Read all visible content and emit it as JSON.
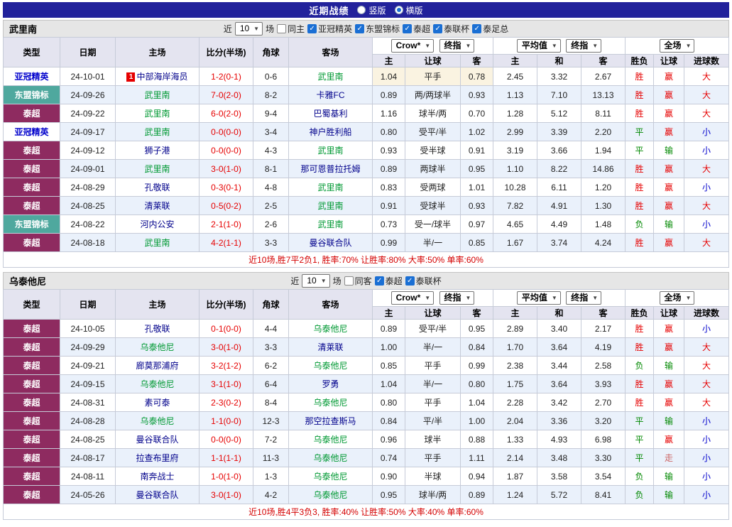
{
  "colors": {
    "topbar_bg": "#22229b",
    "section_bg": "#e6e6e6",
    "header_bg": "#e4e4f0",
    "row_alt_bg": "#eaf1fb",
    "border": "#c6cbd8",
    "score_red": "#e60000",
    "focal_team": "#009933",
    "opponent_team": "#00008b",
    "checkbox_blue": "#1a6fd4",
    "cream": "#faf3e1",
    "summary_red": "#d40000"
  },
  "top_bar": {
    "title": "近期战绩",
    "radio_vertical": "竖版",
    "radio_horizontal": "横版"
  },
  "table_header": {
    "type": "类型",
    "date": "日期",
    "home": "主场",
    "score": "比分(半场)",
    "corner": "角球",
    "away": "客场",
    "odds_source": "Crow*",
    "final_label": "终指",
    "avg_label": "平均值",
    "scope_label": "全场",
    "sub": [
      "主",
      "让球",
      "客",
      "主",
      "和",
      "客",
      "胜负",
      "让球",
      "进球数"
    ]
  },
  "league_styles": {
    "亚冠精英": {
      "bg": "#ffffff",
      "color": "#0000cc"
    },
    "东盟锦标": {
      "bg": "#4fa89e",
      "color": "#ffffff"
    },
    "泰超": {
      "bg": "#8e2b60",
      "color": "#ffffff"
    }
  },
  "value_colors": {
    "胜": "#e60000",
    "平": "#008800",
    "负": "#008800",
    "赢": "#e60000",
    "输": "#008800",
    "走": "#cc6666",
    "大": "#e60000",
    "小": "#0000cc"
  },
  "sections": [
    {
      "team": "武里南",
      "filter": {
        "near_label": "近",
        "count": "10",
        "games_label": "场",
        "same_label": "同主",
        "leagues": [
          "亚冠精英",
          "东盟锦标",
          "泰超",
          "泰联杯",
          "泰足总"
        ]
      },
      "summary": "近10场,胜7平2负1, 胜率:70% 让胜率:80% 大率:50% 单率:60%",
      "rows": [
        {
          "league": "亚冠精英",
          "date": "24-10-01",
          "home": "中部海岸海员",
          "home_badge": "1",
          "score": "1-2(0-1)",
          "corner": "0-6",
          "away": "武里南",
          "away_focal": true,
          "o1": "1.04",
          "hcp": "平手",
          "o2": "0.78",
          "a1": "2.45",
          "a2": "3.32",
          "a3": "2.67",
          "r": "胜",
          "hr": "赢",
          "g": "大",
          "odds_hl": true
        },
        {
          "league": "东盟锦标",
          "date": "24-09-26",
          "home": "武里南",
          "home_focal": true,
          "score": "7-0(2-0)",
          "corner": "8-2",
          "away": "卡雅FC",
          "o1": "0.89",
          "hcp": "两/两球半",
          "o2": "0.93",
          "a1": "1.13",
          "a2": "7.10",
          "a3": "13.13",
          "r": "胜",
          "hr": "赢",
          "g": "大"
        },
        {
          "league": "泰超",
          "date": "24-09-22",
          "home": "武里南",
          "home_focal": true,
          "score": "6-0(2-0)",
          "corner": "9-4",
          "away": "巴蜀基利",
          "o1": "1.16",
          "hcp": "球半/两",
          "o2": "0.70",
          "a1": "1.28",
          "a2": "5.12",
          "a3": "8.11",
          "r": "胜",
          "hr": "赢",
          "g": "大"
        },
        {
          "league": "亚冠精英",
          "date": "24-09-17",
          "home": "武里南",
          "home_focal": true,
          "score": "0-0(0-0)",
          "corner": "3-4",
          "away": "神户胜利船",
          "o1": "0.80",
          "hcp": "受平/半",
          "o2": "1.02",
          "a1": "2.99",
          "a2": "3.39",
          "a3": "2.20",
          "r": "平",
          "hr": "赢",
          "g": "小"
        },
        {
          "league": "泰超",
          "date": "24-09-12",
          "home": "狮子港",
          "score": "0-0(0-0)",
          "corner": "4-3",
          "away": "武里南",
          "away_focal": true,
          "o1": "0.93",
          "hcp": "受半球",
          "o2": "0.91",
          "a1": "3.19",
          "a2": "3.66",
          "a3": "1.94",
          "r": "平",
          "hr": "输",
          "g": "小"
        },
        {
          "league": "泰超",
          "date": "24-09-01",
          "home": "武里南",
          "home_focal": true,
          "score": "3-0(1-0)",
          "corner": "8-1",
          "away": "那可恩普拉托姆",
          "o1": "0.89",
          "hcp": "两球半",
          "o2": "0.95",
          "a1": "1.10",
          "a2": "8.22",
          "a3": "14.86",
          "r": "胜",
          "hr": "赢",
          "g": "大"
        },
        {
          "league": "泰超",
          "date": "24-08-29",
          "home": "孔敬联",
          "score": "0-3(0-1)",
          "corner": "4-8",
          "away": "武里南",
          "away_focal": true,
          "o1": "0.83",
          "hcp": "受两球",
          "o2": "1.01",
          "a1": "10.28",
          "a2": "6.11",
          "a3": "1.20",
          "r": "胜",
          "hr": "赢",
          "g": "小"
        },
        {
          "league": "泰超",
          "date": "24-08-25",
          "home": "清莱联",
          "score": "0-5(0-2)",
          "corner": "2-5",
          "away": "武里南",
          "away_focal": true,
          "o1": "0.91",
          "hcp": "受球半",
          "o2": "0.93",
          "a1": "7.82",
          "a2": "4.91",
          "a3": "1.30",
          "r": "胜",
          "hr": "赢",
          "g": "大"
        },
        {
          "league": "东盟锦标",
          "date": "24-08-22",
          "home": "河内公安",
          "score": "2-1(1-0)",
          "corner": "2-6",
          "away": "武里南",
          "away_focal": true,
          "o1": "0.73",
          "hcp": "受一/球半",
          "o2": "0.97",
          "a1": "4.65",
          "a2": "4.49",
          "a3": "1.48",
          "r": "负",
          "hr": "输",
          "g": "小"
        },
        {
          "league": "泰超",
          "date": "24-08-18",
          "home": "武里南",
          "home_focal": true,
          "score": "4-2(1-1)",
          "corner": "3-3",
          "away": "曼谷联合队",
          "o1": "0.99",
          "hcp": "半/一",
          "o2": "0.85",
          "a1": "1.67",
          "a2": "3.74",
          "a3": "4.24",
          "r": "胜",
          "hr": "赢",
          "g": "大"
        }
      ]
    },
    {
      "team": "乌泰他尼",
      "filter": {
        "near_label": "近",
        "count": "10",
        "games_label": "场",
        "same_label": "同客",
        "leagues": [
          "泰超",
          "泰联杯"
        ]
      },
      "summary": "近10场,胜4平3负3, 胜率:40% 让胜率:50% 大率:40% 单率:60%",
      "rows": [
        {
          "league": "泰超",
          "date": "24-10-05",
          "home": "孔敬联",
          "score": "0-1(0-0)",
          "corner": "4-4",
          "away": "乌泰他尼",
          "away_focal": true,
          "o1": "0.89",
          "hcp": "受平/半",
          "o2": "0.95",
          "a1": "2.89",
          "a2": "3.40",
          "a3": "2.17",
          "r": "胜",
          "hr": "赢",
          "g": "小"
        },
        {
          "league": "泰超",
          "date": "24-09-29",
          "home": "乌泰他尼",
          "home_focal": true,
          "score": "3-0(1-0)",
          "corner": "3-3",
          "away": "清莱联",
          "o1": "1.00",
          "hcp": "半/一",
          "o2": "0.84",
          "a1": "1.70",
          "a2": "3.64",
          "a3": "4.19",
          "r": "胜",
          "hr": "赢",
          "g": "大"
        },
        {
          "league": "泰超",
          "date": "24-09-21",
          "home": "廊莫那浦府",
          "score": "3-2(1-2)",
          "corner": "6-2",
          "away": "乌泰他尼",
          "away_focal": true,
          "o1": "0.85",
          "hcp": "平手",
          "o2": "0.99",
          "a1": "2.38",
          "a2": "3.44",
          "a3": "2.58",
          "r": "负",
          "hr": "输",
          "g": "大"
        },
        {
          "league": "泰超",
          "date": "24-09-15",
          "home": "乌泰他尼",
          "home_focal": true,
          "score": "3-1(1-0)",
          "corner": "6-4",
          "away": "罗勇",
          "o1": "1.04",
          "hcp": "半/一",
          "o2": "0.80",
          "a1": "1.75",
          "a2": "3.64",
          "a3": "3.93",
          "r": "胜",
          "hr": "赢",
          "g": "大"
        },
        {
          "league": "泰超",
          "date": "24-08-31",
          "home": "素可泰",
          "score": "2-3(0-2)",
          "corner": "8-4",
          "away": "乌泰他尼",
          "away_focal": true,
          "o1": "0.80",
          "hcp": "平手",
          "o2": "1.04",
          "a1": "2.28",
          "a2": "3.42",
          "a3": "2.70",
          "r": "胜",
          "hr": "赢",
          "g": "大"
        },
        {
          "league": "泰超",
          "date": "24-08-28",
          "home": "乌泰他尼",
          "home_focal": true,
          "score": "1-1(0-0)",
          "corner": "12-3",
          "away": "那空拉查斯马",
          "o1": "0.84",
          "hcp": "平/半",
          "o2": "1.00",
          "a1": "2.04",
          "a2": "3.36",
          "a3": "3.20",
          "r": "平",
          "hr": "输",
          "g": "小"
        },
        {
          "league": "泰超",
          "date": "24-08-25",
          "home": "曼谷联合队",
          "score": "0-0(0-0)",
          "corner": "7-2",
          "away": "乌泰他尼",
          "away_focal": true,
          "o1": "0.96",
          "hcp": "球半",
          "o2": "0.88",
          "a1": "1.33",
          "a2": "4.93",
          "a3": "6.98",
          "r": "平",
          "hr": "赢",
          "g": "小"
        },
        {
          "league": "泰超",
          "date": "24-08-17",
          "home": "拉查布里府",
          "score": "1-1(1-1)",
          "corner": "11-3",
          "away": "乌泰他尼",
          "away_focal": true,
          "o1": "0.74",
          "hcp": "平手",
          "o2": "1.11",
          "a1": "2.14",
          "a2": "3.48",
          "a3": "3.30",
          "r": "平",
          "hr": "走",
          "g": "小"
        },
        {
          "league": "泰超",
          "date": "24-08-11",
          "home": "南奔战士",
          "score": "1-0(1-0)",
          "corner": "1-3",
          "away": "乌泰他尼",
          "away_focal": true,
          "o1": "0.90",
          "hcp": "半球",
          "o2": "0.94",
          "a1": "1.87",
          "a2": "3.58",
          "a3": "3.54",
          "r": "负",
          "hr": "输",
          "g": "小"
        },
        {
          "league": "泰超",
          "date": "24-05-26",
          "home": "曼谷联合队",
          "score": "3-0(1-0)",
          "corner": "4-2",
          "away": "乌泰他尼",
          "away_focal": true,
          "o1": "0.95",
          "hcp": "球半/两",
          "o2": "0.89",
          "a1": "1.24",
          "a2": "5.72",
          "a3": "8.41",
          "r": "负",
          "hr": "输",
          "g": "小"
        }
      ]
    }
  ]
}
